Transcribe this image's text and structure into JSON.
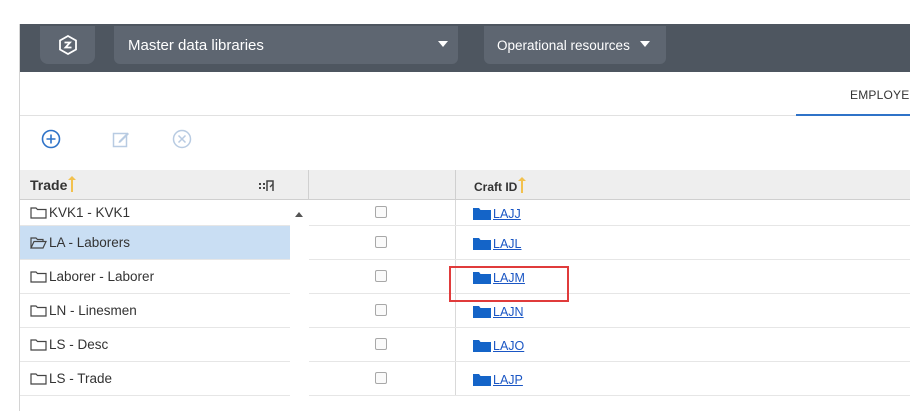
{
  "topbar": {
    "logo_icon": "app-logo-icon",
    "library_dropdown": "Master data libraries",
    "resources_dropdown": "Operational resources"
  },
  "tabs": {
    "employees": "EMPLOYE"
  },
  "toolbar": {
    "add_icon": "add-circle-icon",
    "edit_icon": "edit-icon",
    "delete_icon": "delete-circle-icon"
  },
  "trade_grid": {
    "header": "Trade",
    "rows": [
      {
        "label": "KVK1 - KVK1",
        "selected": false
      },
      {
        "label": "LA - Laborers",
        "selected": true
      },
      {
        "label": "Laborer - Laborer",
        "selected": false
      },
      {
        "label": "LN - Linesmen",
        "selected": false
      },
      {
        "label": "LS - Desc",
        "selected": false
      },
      {
        "label": "LS - Trade",
        "selected": false
      }
    ]
  },
  "craft_grid": {
    "header": "Craft ID",
    "rows": [
      {
        "id": "LAJJ"
      },
      {
        "id": "LAJL"
      },
      {
        "id": "LAJM"
      },
      {
        "id": "LAJN"
      },
      {
        "id": "LAJO"
      },
      {
        "id": "LAJP"
      }
    ]
  },
  "colors": {
    "topbar": "#4e5660",
    "accent": "#2f73c8",
    "selection": "#c9def3",
    "highlight": "#e03b3b",
    "link": "#1a56c4"
  }
}
